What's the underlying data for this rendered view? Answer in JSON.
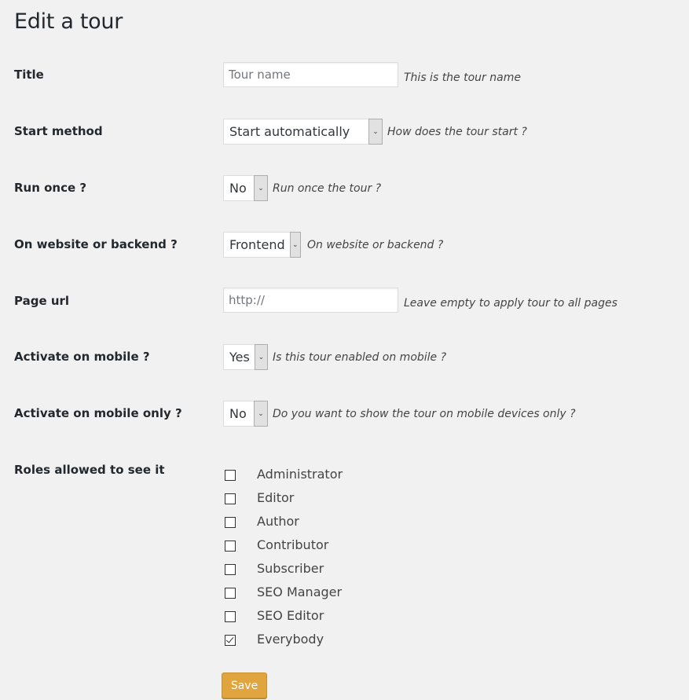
{
  "page": {
    "title": "Edit a tour"
  },
  "fields": {
    "title": {
      "label": "Title",
      "placeholder": "Tour name",
      "value": "",
      "hint": "This is the tour name"
    },
    "start_method": {
      "label": "Start method",
      "selected": "Start automatically",
      "hint": "How does the tour start ?"
    },
    "run_once": {
      "label": "Run once ?",
      "selected": "No",
      "hint": "Run once the tour ?"
    },
    "location": {
      "label": "On website or backend ?",
      "selected": "Frontend",
      "hint": "On website or backend ?"
    },
    "page_url": {
      "label": "Page url",
      "placeholder": "http://",
      "value": "",
      "hint": "Leave empty to apply tour to all pages"
    },
    "mobile": {
      "label": "Activate on mobile ?",
      "selected": "Yes",
      "hint": "Is this tour enabled on mobile ?"
    },
    "mobile_only": {
      "label": "Activate on mobile only ?",
      "selected": "No",
      "hint": "Do you want to show the tour on mobile devices only ?"
    },
    "roles": {
      "label": "Roles allowed to see it",
      "items": [
        {
          "label": "Administrator",
          "checked": false
        },
        {
          "label": "Editor",
          "checked": false
        },
        {
          "label": "Author",
          "checked": false
        },
        {
          "label": "Contributor",
          "checked": false
        },
        {
          "label": "Subscriber",
          "checked": false
        },
        {
          "label": "SEO Manager",
          "checked": false
        },
        {
          "label": "SEO Editor",
          "checked": false
        },
        {
          "label": "Everybody",
          "checked": true
        }
      ]
    }
  },
  "actions": {
    "save_label": "Save"
  },
  "icons": {
    "select_arrow": "chevron-down-icon",
    "checkbox_checked": "checkmark-icon"
  },
  "colors": {
    "background": "#f1f1f1",
    "save_button": "#e0a53f",
    "text": "#23282d"
  }
}
